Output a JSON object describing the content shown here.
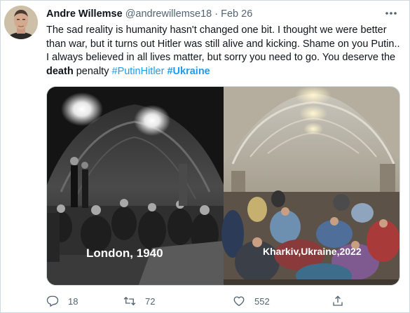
{
  "tweet": {
    "author_name": "Andre Willemse",
    "handle": "@andrewillemse18",
    "separator": "·",
    "date": "Feb 26",
    "text": {
      "part1": "The sad reality is humanity hasn't changed one bit. I thought we were better than war, but it turns out Hitler was still alive and kicking. Shame on you Putin.. I always believed in all lives matter, but sorry you need to go. You deserve the ",
      "bold_word": "death",
      "part2": " penalty ",
      "hashtag1": "#PutinHitler",
      "space": " ",
      "hashtag2": "#Ukraine"
    },
    "media": {
      "left_caption": "London, 1940",
      "right_caption": "Kharkiv,Ukraine,2022"
    },
    "actions": {
      "reply_count": "18",
      "retweet_count": "72",
      "like_count": "552"
    },
    "icons": [
      "more-icon",
      "reply-icon",
      "retweet-icon",
      "like-icon",
      "share-icon"
    ],
    "colors": {
      "link": "#1d9bf0",
      "secondary": "#536471",
      "border": "#cfd9de"
    }
  }
}
